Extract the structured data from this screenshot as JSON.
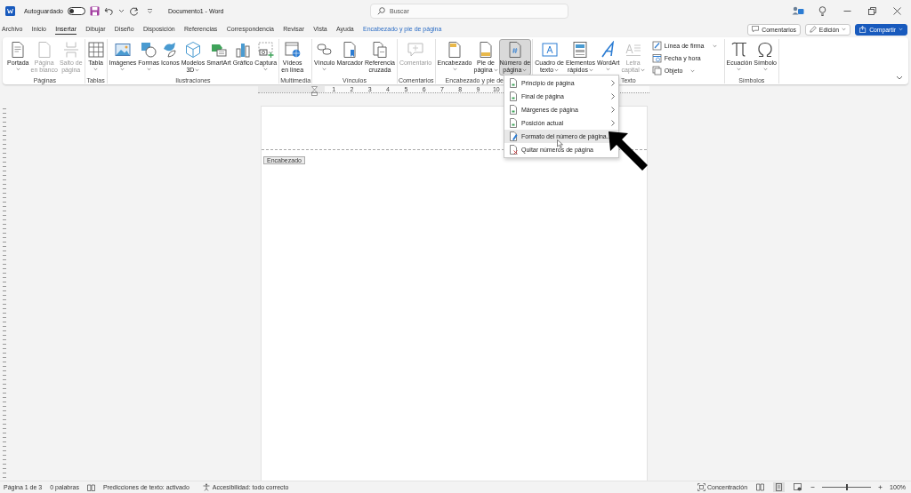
{
  "title_bar": {
    "autosave_label": "Autoguardado",
    "autosave_on": false,
    "document_title": "Documento1  -  Word",
    "search": {
      "placeholder": "Buscar"
    }
  },
  "tabs": [
    {
      "label": "Archivo",
      "selected": false,
      "kind": "normal"
    },
    {
      "label": "Inicio",
      "selected": false,
      "kind": "normal"
    },
    {
      "label": "Insertar",
      "selected": true,
      "kind": "normal"
    },
    {
      "label": "Dibujar",
      "selected": false,
      "kind": "normal"
    },
    {
      "label": "Diseño",
      "selected": false,
      "kind": "normal"
    },
    {
      "label": "Disposición",
      "selected": false,
      "kind": "normal"
    },
    {
      "label": "Referencias",
      "selected": false,
      "kind": "normal"
    },
    {
      "label": "Correspondencia",
      "selected": false,
      "kind": "normal"
    },
    {
      "label": "Revisar",
      "selected": false,
      "kind": "normal"
    },
    {
      "label": "Vista",
      "selected": false,
      "kind": "normal"
    },
    {
      "label": "Ayuda",
      "selected": false,
      "kind": "normal"
    },
    {
      "label": "Encabezado y pie de página",
      "selected": false,
      "kind": "contextual"
    }
  ],
  "actions": [
    {
      "label": "Comentarios",
      "kind": "comments"
    },
    {
      "label": "Edición",
      "kind": "editing"
    },
    {
      "label": "Compartir",
      "kind": "share"
    }
  ],
  "ribbon": {
    "groups": [
      {
        "label": "Páginas",
        "commands": [
          {
            "label": "Portada",
            "caret": true,
            "disabled": false,
            "pressed": false,
            "kind": "large"
          },
          {
            "label": "Página\nen blanco",
            "caret": false,
            "disabled": true,
            "pressed": false,
            "kind": "large"
          },
          {
            "label": "Salto de\npágina",
            "caret": false,
            "disabled": true,
            "pressed": false,
            "kind": "large"
          }
        ]
      },
      {
        "label": "Tablas",
        "commands": [
          {
            "label": "Tabla",
            "caret": true,
            "disabled": false,
            "pressed": false,
            "kind": "large"
          }
        ]
      },
      {
        "label": "Ilustraciones",
        "commands": [
          {
            "label": "Imágenes",
            "caret": true,
            "disabled": false,
            "pressed": false,
            "kind": "large"
          },
          {
            "label": "Formas",
            "caret": true,
            "disabled": false,
            "pressed": false,
            "kind": "large"
          },
          {
            "label": "Iconos",
            "caret": false,
            "disabled": false,
            "pressed": false,
            "kind": "large"
          },
          {
            "label": "Modelos\n3D",
            "caret": true,
            "disabled": false,
            "pressed": false,
            "kind": "compact"
          },
          {
            "label": "SmartArt",
            "caret": false,
            "disabled": false,
            "pressed": false,
            "kind": "large"
          },
          {
            "label": "Gráfico",
            "caret": false,
            "disabled": false,
            "pressed": false,
            "kind": "large"
          },
          {
            "label": "Captura",
            "caret": true,
            "disabled": false,
            "pressed": false,
            "kind": "large"
          }
        ]
      },
      {
        "label": "Multimedia",
        "commands": [
          {
            "label": "Vídeos\nen línea",
            "caret": false,
            "disabled": false,
            "pressed": false,
            "kind": "large"
          }
        ]
      },
      {
        "label": "Vínculos",
        "commands": [
          {
            "label": "Vínculo",
            "caret": true,
            "disabled": false,
            "pressed": false,
            "kind": "large"
          },
          {
            "label": "Marcador",
            "caret": false,
            "disabled": false,
            "pressed": false,
            "kind": "large"
          },
          {
            "label": "Referencia\ncruzada",
            "caret": false,
            "disabled": false,
            "pressed": false,
            "kind": "large"
          }
        ]
      },
      {
        "label": "Comentarios",
        "commands": [
          {
            "label": "Comentario",
            "caret": false,
            "disabled": true,
            "pressed": false,
            "kind": "large"
          }
        ]
      },
      {
        "label": "Encabezado y pie de",
        "commands": [
          {
            "label": "Encabezado",
            "caret": true,
            "disabled": false,
            "pressed": false,
            "kind": "large"
          },
          {
            "label": "Pie de\npágina",
            "caret": true,
            "disabled": false,
            "pressed": false,
            "kind": "compact"
          },
          {
            "label": "Número de\npágina",
            "caret": true,
            "disabled": false,
            "pressed": true,
            "kind": "compact"
          }
        ]
      },
      {
        "label": "Texto",
        "commands": [
          {
            "label": "Cuadro de\ntexto",
            "caret": true,
            "disabled": false,
            "pressed": false,
            "kind": "compact"
          },
          {
            "label": "Elementos\nrápidos",
            "caret": true,
            "disabled": false,
            "pressed": false,
            "kind": "compact"
          },
          {
            "label": "WordArt",
            "caret": true,
            "disabled": false,
            "pressed": false,
            "kind": "large"
          },
          {
            "label": "Letra\ncapital",
            "caret": true,
            "disabled": true,
            "pressed": false,
            "kind": "compact"
          },
          {
            "label": "Línea de firma",
            "caret": true,
            "disabled": false,
            "pressed": false,
            "kind": "small"
          },
          {
            "label": "Fecha y hora",
            "caret": false,
            "disabled": false,
            "pressed": false,
            "kind": "small"
          },
          {
            "label": "Objeto",
            "caret": true,
            "disabled": false,
            "pressed": false,
            "kind": "small"
          }
        ]
      },
      {
        "label": "Símbolos",
        "commands": [
          {
            "label": "Ecuación",
            "caret": true,
            "disabled": false,
            "pressed": false,
            "kind": "large"
          },
          {
            "label": "Símbolo",
            "caret": true,
            "disabled": false,
            "pressed": false,
            "kind": "large"
          }
        ]
      }
    ]
  },
  "ruler": {
    "numbers": [
      "1",
      "2",
      "3",
      "4",
      "5",
      "6",
      "7",
      "8",
      "9",
      "10"
    ]
  },
  "document": {
    "header_tag": "Encabezado"
  },
  "menu": {
    "items": [
      {
        "label": "Principio de página",
        "submenu": true,
        "hovered": false
      },
      {
        "label": "Final de página",
        "submenu": true,
        "hovered": false
      },
      {
        "label": "Márgenes de página",
        "submenu": true,
        "hovered": false
      },
      {
        "label": "Posición actual",
        "submenu": true,
        "hovered": false
      },
      {
        "label": "Formato del número de página...",
        "submenu": false,
        "hovered": true
      },
      {
        "label": "Quitar números de página",
        "submenu": false,
        "hovered": false
      }
    ]
  },
  "status_bar": {
    "items": [
      {
        "label": "Página 1 de 3",
        "kind": "plain"
      },
      {
        "label": "0 palabras",
        "kind": "plain"
      },
      {
        "label": "Predicciones de texto: activado",
        "kind": "proofing"
      },
      {
        "label": "Accesibilidad: todo correcto",
        "kind": "accessibility"
      }
    ],
    "focus_label": "Concentración",
    "views": [
      {
        "selected": false
      },
      {
        "selected": true
      },
      {
        "selected": false
      }
    ],
    "zoom": {
      "level": 0.5,
      "reading": "100%"
    }
  }
}
